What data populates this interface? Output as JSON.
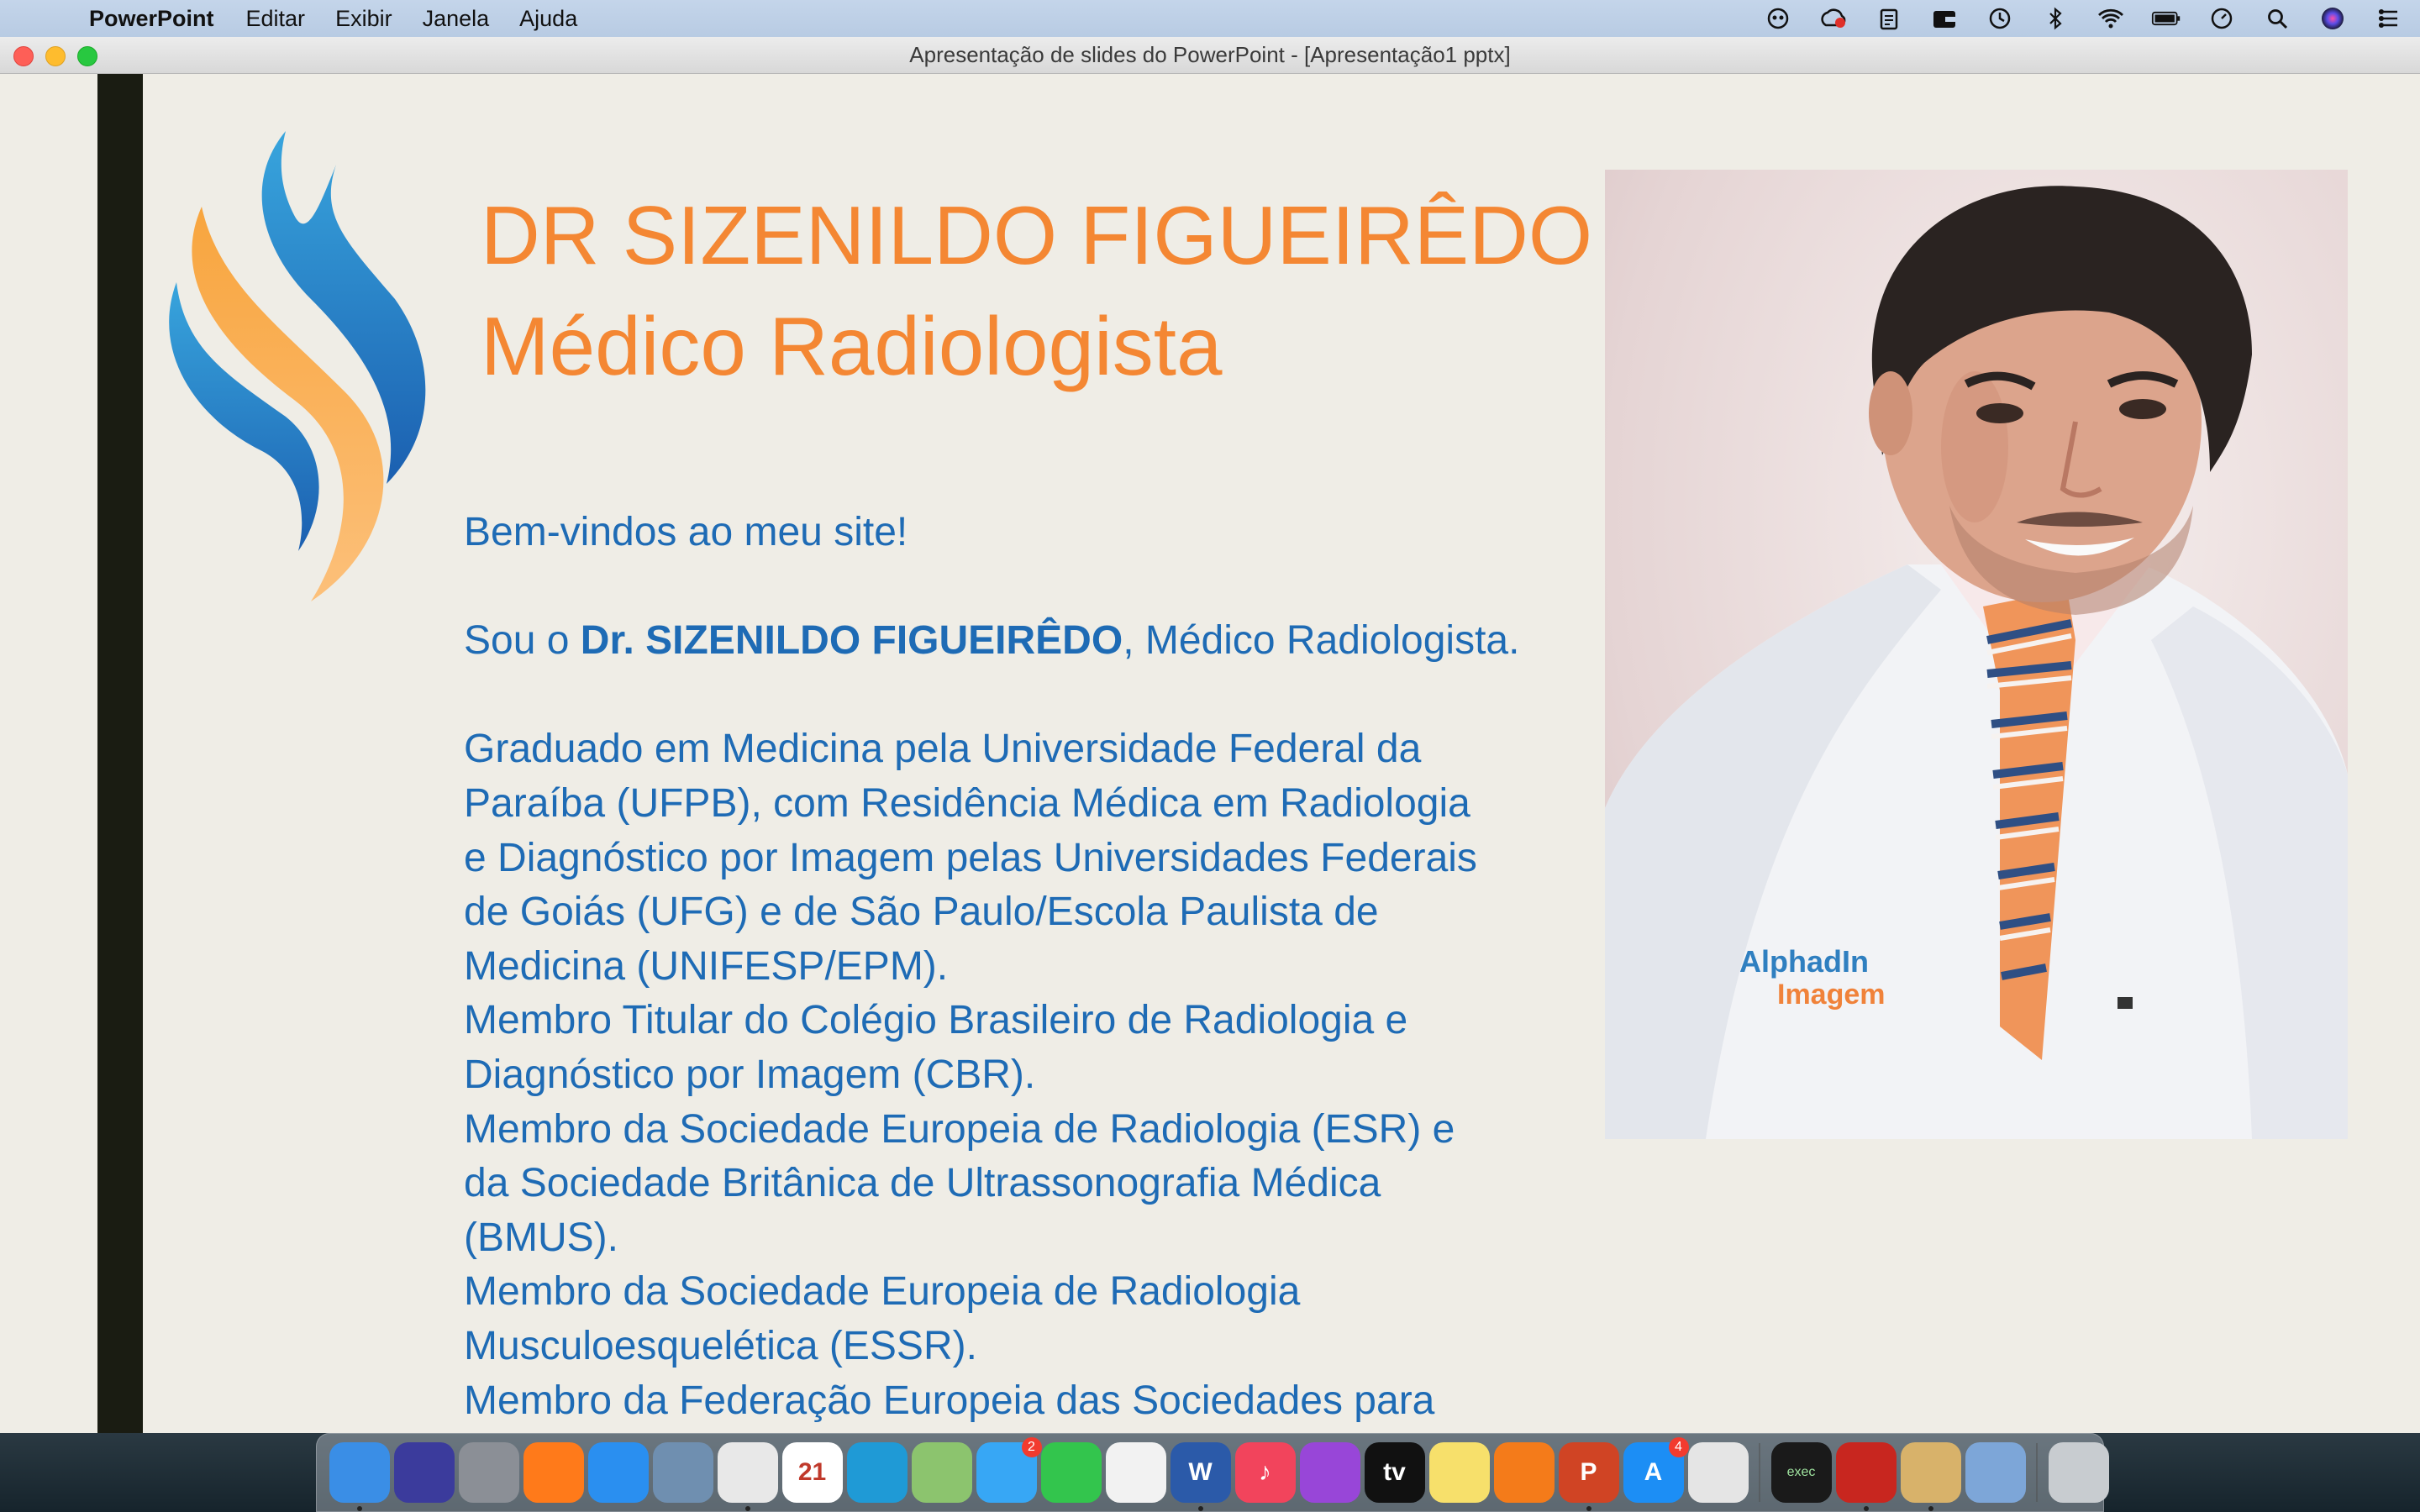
{
  "menubar": {
    "apple_glyph": "",
    "app_name": "PowerPoint",
    "menus": [
      "Editar",
      "Exibir",
      "Janela",
      "Ajuda"
    ],
    "status_icons": [
      "robot-icon",
      "creative-cloud-icon",
      "clipboard-icon",
      "wallet-icon",
      "time-machine-icon",
      "bluetooth-icon",
      "wifi-icon",
      "battery-icon",
      "clock-icon",
      "spotlight-search-icon",
      "siri-icon",
      "control-center-icon"
    ]
  },
  "window": {
    "title": "Apresentação de slides do PowerPoint - [Apresentação1 pptx]"
  },
  "slide": {
    "title_line_1": "DR SIZENILDO FIGUEIRÊDO",
    "title_line_2": "Médico Radiologista",
    "greeting": "Bem-vindos ao meu site!",
    "intro_prefix": "Sou o ",
    "intro_name": "Dr. SIZENILDO FIGUEIRÊDO",
    "intro_suffix": ", Médico Radiologista.",
    "bio_lines": [
      "Graduado em Medicina pela Universidade Federal da",
      "Paraíba (UFPB), com Residência Médica em Radiologia",
      "e Diagnóstico por Imagem pelas Universidades Federais",
      "de Goiás (UFG) e de São Paulo/Escola Paulista de",
      "Medicina (UNIFESP/EPM).",
      "Membro Titular do Colégio Brasileiro de Radiologia e",
      "Diagnóstico por Imagem (CBR).",
      "Membro da Sociedade Europeia de Radiologia (ESR) e",
      "da Sociedade Britânica de Ultrassonografia Médica",
      "(BMUS).",
      "Membro da Sociedade Europeia de Radiologia",
      "Musculoesquelética (ESSR).",
      "Membro da Federação Europeia das Sociedades para"
    ],
    "photo_logo_line_1": "AlphadIn",
    "photo_logo_line_2": "Imagem",
    "colors": {
      "title_orange": "#f48733",
      "body_blue": "#1e6bb5",
      "background": "#efede6",
      "left_bar": "#1a1c12"
    }
  },
  "dock": {
    "items": [
      {
        "name": "finder-icon",
        "label": "",
        "color": "#3a8ee6",
        "running": true
      },
      {
        "name": "siri-app-icon",
        "label": "",
        "color": "#3b3b9c",
        "running": false
      },
      {
        "name": "launchpad-icon",
        "label": "",
        "color": "#8b8f96",
        "running": false
      },
      {
        "name": "firefox-icon",
        "label": "",
        "color": "#ff7a1a",
        "running": false
      },
      {
        "name": "safari-icon",
        "label": "",
        "color": "#2a8ff0",
        "running": false
      },
      {
        "name": "preview-app-icon",
        "label": "",
        "color": "#6f8fb0",
        "running": false
      },
      {
        "name": "chrome-icon",
        "label": "",
        "color": "#e8e8e8",
        "running": true
      },
      {
        "name": "calendar-icon",
        "label": "21",
        "color": "#ffffff",
        "running": false
      },
      {
        "name": "maps-bird-icon",
        "label": "",
        "color": "#1f9ad6",
        "running": false
      },
      {
        "name": "maps-icon",
        "label": "",
        "color": "#8cc46e",
        "running": false
      },
      {
        "name": "messages-icon",
        "label": "",
        "color": "#37a7f5",
        "running": false,
        "badge": "2"
      },
      {
        "name": "facetime-icon",
        "label": "",
        "color": "#33c54d",
        "running": false
      },
      {
        "name": "photos-icon",
        "label": "",
        "color": "#f2f2f2",
        "running": false
      },
      {
        "name": "word-icon",
        "label": "W",
        "color": "#2b5aa9",
        "running": true
      },
      {
        "name": "music-icon",
        "label": "♪",
        "color": "#f2445c",
        "running": false
      },
      {
        "name": "podcasts-icon",
        "label": "",
        "color": "#9846d8",
        "running": false
      },
      {
        "name": "apple-tv-icon",
        "label": "tv",
        "color": "#111111",
        "running": false
      },
      {
        "name": "notes-icon",
        "label": "",
        "color": "#f7e06b",
        "running": false
      },
      {
        "name": "books-icon",
        "label": "",
        "color": "#f47b1a",
        "running": false
      },
      {
        "name": "powerpoint-icon",
        "label": "P",
        "color": "#d04424",
        "running": true
      },
      {
        "name": "app-store-icon",
        "label": "A",
        "color": "#1c8ef5",
        "running": false,
        "badge": "4"
      },
      {
        "name": "acrobat-icon",
        "label": "",
        "color": "#e5e5e5",
        "running": false
      },
      {
        "name": "terminal-icon",
        "label": "exec",
        "color": "#1a1a1a",
        "running": false
      },
      {
        "name": "acrobat-reader-icon",
        "label": "",
        "color": "#c8261f",
        "running": true
      },
      {
        "name": "archive-utility-icon",
        "label": "",
        "color": "#d8b26a",
        "running": true
      },
      {
        "name": "preview-icon",
        "label": "",
        "color": "#7da6d8",
        "running": false
      },
      {
        "name": "trash-icon",
        "label": "",
        "color": "#c8ccd0",
        "running": false
      }
    ]
  }
}
